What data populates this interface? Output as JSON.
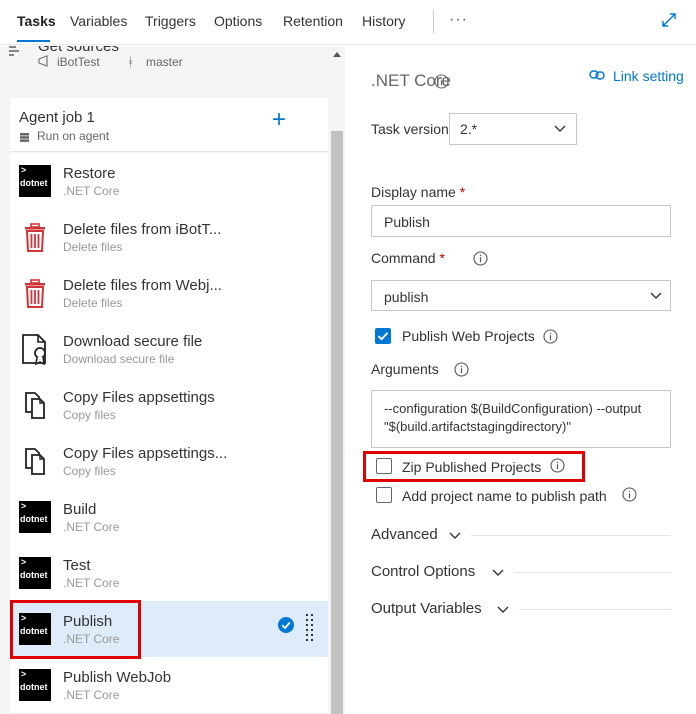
{
  "tabs": [
    {
      "label": "Tasks"
    },
    {
      "label": "Variables"
    },
    {
      "label": "Triggers"
    },
    {
      "label": "Options"
    },
    {
      "label": "Retention"
    },
    {
      "label": "History"
    }
  ],
  "nav": {
    "more_label": "···"
  },
  "get_sources": {
    "title": "Get sources",
    "repo": "iBotTest",
    "branch": "master"
  },
  "agent_job": {
    "title": "Agent job 1",
    "subtitle": "Run on agent",
    "add_label": "+"
  },
  "tasks": [
    {
      "title": "Restore",
      "subtitle": ".NET Core",
      "icon": "dotnet-icon"
    },
    {
      "title": "Delete files from iBotT...",
      "subtitle": "Delete files",
      "icon": "trash-icon"
    },
    {
      "title": "Delete files from Webj...",
      "subtitle": "Delete files",
      "icon": "trash-icon"
    },
    {
      "title": "Download secure file",
      "subtitle": "Download secure file",
      "icon": "secure-file-icon"
    },
    {
      "title": "Copy Files appsettings",
      "subtitle": "Copy files",
      "icon": "copy-files-icon"
    },
    {
      "title": "Copy Files appsettings...",
      "subtitle": "Copy files",
      "icon": "copy-files-icon"
    },
    {
      "title": "Build",
      "subtitle": ".NET Core",
      "icon": "dotnet-icon"
    },
    {
      "title": "Test",
      "subtitle": ".NET Core",
      "icon": "dotnet-icon"
    },
    {
      "title": "Publish",
      "subtitle": ".NET Core",
      "icon": "dotnet-icon",
      "selected": true
    },
    {
      "title": "Publish WebJob",
      "subtitle": ".NET Core",
      "icon": "dotnet-icon"
    }
  ],
  "dotnet_badge": {
    "text": "dotnet",
    "chevron": ">"
  },
  "details": {
    "title": ".NET Core",
    "link_settings": "Link setting",
    "task_version_label": "Task version",
    "task_version_value": "2.*",
    "display_name_label": "Display name",
    "display_name_value": "Publish",
    "command_label": "Command",
    "command_value": "publish",
    "required_mark": "*",
    "publish_web_projects_label": "Publish Web Projects",
    "publish_web_projects_checked": true,
    "arguments_label": "Arguments",
    "arguments_value": "--configuration $(BuildConfiguration) --output \"$(build.artifactstagingdirectory)\"",
    "zip_label": "Zip Published Projects",
    "zip_checked": false,
    "add_project_name_label": "Add project name to publish path",
    "add_project_name_checked": false,
    "sections": [
      "Advanced",
      "Control Options",
      "Output Variables"
    ]
  },
  "colors": {
    "accent": "#0078d4",
    "highlight": "#e00000",
    "selected_row": "#deecf9",
    "trash": "#d13438"
  }
}
